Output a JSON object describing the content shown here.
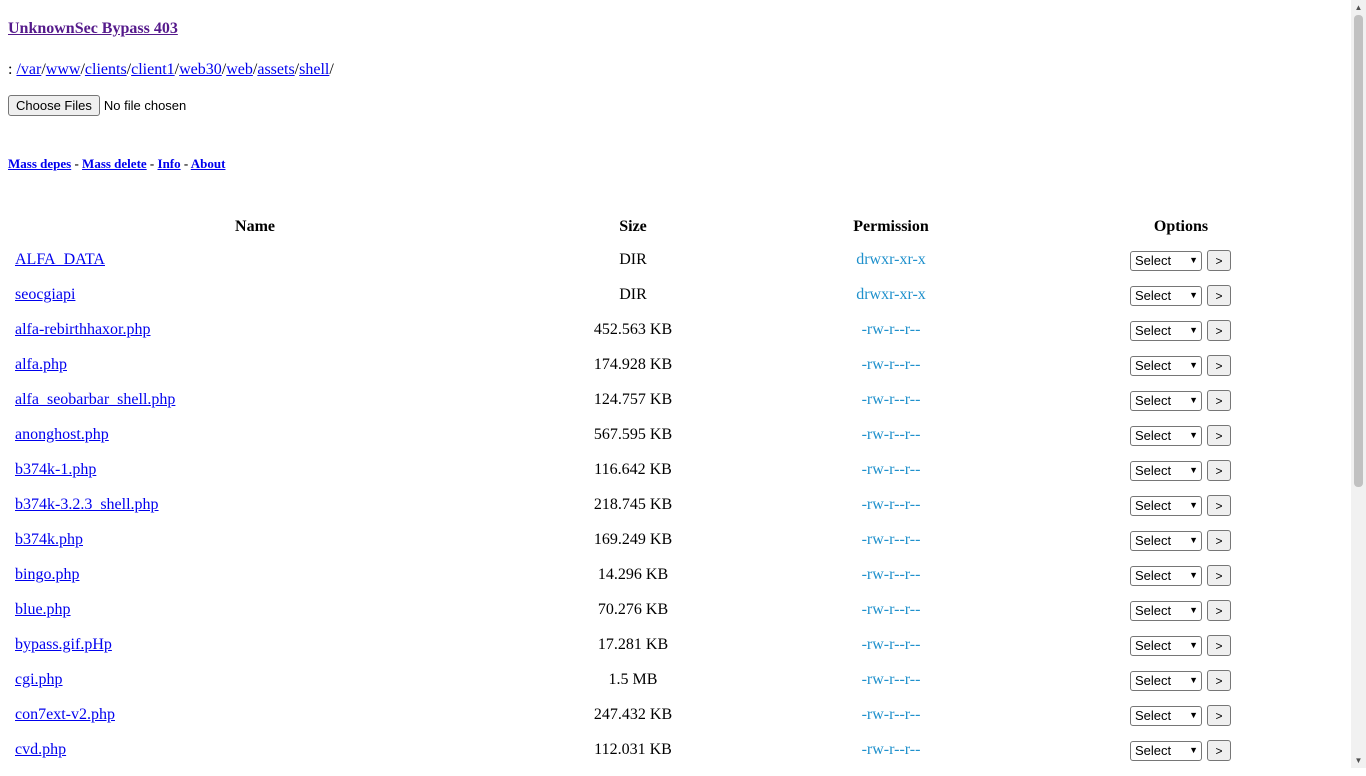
{
  "header": {
    "title": "UnknownSec Bypass 403"
  },
  "path": {
    "prefix": ":",
    "segments": [
      "/var",
      "www",
      "clients",
      "client1",
      "web30",
      "web",
      "assets",
      "shell"
    ],
    "separator": "/"
  },
  "upload": {
    "button_label": "Choose Files",
    "status": "No file chosen"
  },
  "menu": {
    "items": [
      "Mass depes",
      "Mass delete",
      "Info",
      "About"
    ],
    "separator": "-"
  },
  "table": {
    "headers": {
      "name": "Name",
      "size": "Size",
      "permission": "Permission",
      "options": "Options"
    },
    "select_label": "Select",
    "go_label": ">",
    "rows": [
      {
        "name": "ALFA_DATA",
        "size": "DIR",
        "perm": "drwxr-xr-x"
      },
      {
        "name": "seocgiapi",
        "size": "DIR",
        "perm": "drwxr-xr-x"
      },
      {
        "name": "alfa-rebirthhaxor.php",
        "size": "452.563 KB",
        "perm": "-rw-r--r--"
      },
      {
        "name": "alfa.php",
        "size": "174.928 KB",
        "perm": "-rw-r--r--"
      },
      {
        "name": "alfa_seobarbar_shell.php",
        "size": "124.757 KB",
        "perm": "-rw-r--r--"
      },
      {
        "name": "anonghost.php",
        "size": "567.595 KB",
        "perm": "-rw-r--r--"
      },
      {
        "name": "b374k-1.php",
        "size": "116.642 KB",
        "perm": "-rw-r--r--"
      },
      {
        "name": "b374k-3.2.3_shell.php",
        "size": "218.745 KB",
        "perm": "-rw-r--r--"
      },
      {
        "name": "b374k.php",
        "size": "169.249 KB",
        "perm": "-rw-r--r--"
      },
      {
        "name": "bingo.php",
        "size": "14.296 KB",
        "perm": "-rw-r--r--"
      },
      {
        "name": "blue.php",
        "size": "70.276 KB",
        "perm": "-rw-r--r--"
      },
      {
        "name": "bypass.gif.pHp",
        "size": "17.281 KB",
        "perm": "-rw-r--r--"
      },
      {
        "name": "cgi.php",
        "size": "1.5 MB",
        "perm": "-rw-r--r--"
      },
      {
        "name": "con7ext-v2.php",
        "size": "247.432 KB",
        "perm": "-rw-r--r--"
      },
      {
        "name": "cvd.php",
        "size": "112.031 KB",
        "perm": "-rw-r--r--"
      }
    ]
  },
  "colors": {
    "title": "#551a8b",
    "link": "#0000ee",
    "permission": "#1e90cc"
  },
  "icons": {
    "select_arrow": "chevron-down-icon",
    "scroll_up": "scroll-up-icon",
    "scroll_down": "scroll-down-icon"
  },
  "scroll": {
    "visible_fraction": 0.64,
    "position": 0.0
  }
}
